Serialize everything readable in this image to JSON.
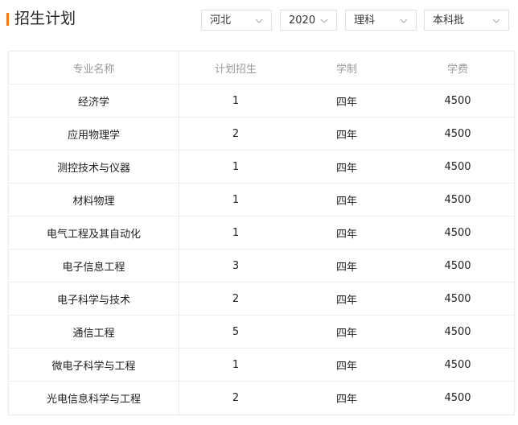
{
  "header": {
    "title": "招生计划",
    "filters": [
      {
        "name": "province",
        "value": "河北"
      },
      {
        "name": "year",
        "value": "2020"
      },
      {
        "name": "subject",
        "value": "理科"
      },
      {
        "name": "batch",
        "value": "本科批"
      }
    ]
  },
  "table": {
    "columns": [
      "专业名称",
      "计划招生",
      "学制",
      "学费"
    ],
    "rows": [
      {
        "major": "经济学",
        "plan": "1",
        "duration": "四年",
        "fee": "4500"
      },
      {
        "major": "应用物理学",
        "plan": "2",
        "duration": "四年",
        "fee": "4500"
      },
      {
        "major": "测控技术与仪器",
        "plan": "1",
        "duration": "四年",
        "fee": "4500"
      },
      {
        "major": "材料物理",
        "plan": "1",
        "duration": "四年",
        "fee": "4500"
      },
      {
        "major": "电气工程及其自动化",
        "plan": "1",
        "duration": "四年",
        "fee": "4500"
      },
      {
        "major": "电子信息工程",
        "plan": "3",
        "duration": "四年",
        "fee": "4500"
      },
      {
        "major": "电子科学与技术",
        "plan": "2",
        "duration": "四年",
        "fee": "4500"
      },
      {
        "major": "通信工程",
        "plan": "5",
        "duration": "四年",
        "fee": "4500"
      },
      {
        "major": "微电子科学与工程",
        "plan": "1",
        "duration": "四年",
        "fee": "4500"
      },
      {
        "major": "光电信息科学与工程",
        "plan": "2",
        "duration": "四年",
        "fee": "4500"
      }
    ]
  },
  "colors": {
    "accent": "#f07a10",
    "border": "#ededed",
    "header_text": "#999999"
  }
}
